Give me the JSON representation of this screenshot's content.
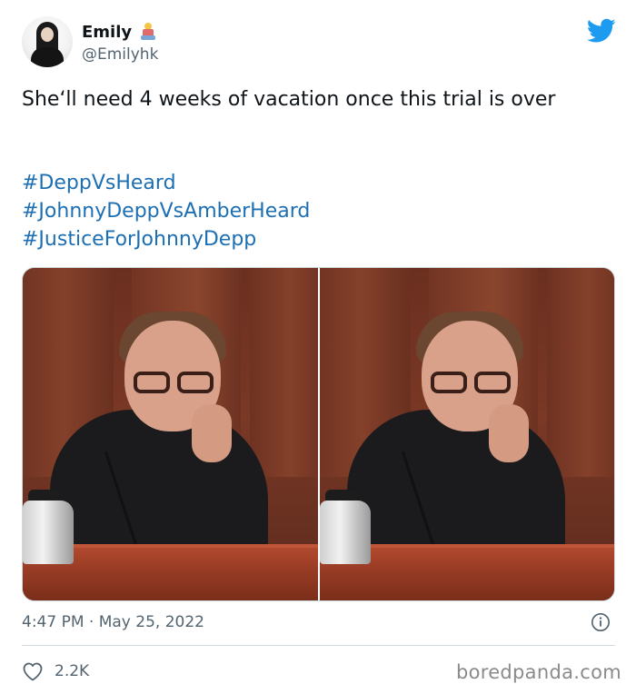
{
  "user": {
    "display_name": "Emily",
    "handle": "@Emilyhk",
    "avatar_icon": "profile-photo",
    "badge_icon": "emoji-badge-icon"
  },
  "brand": {
    "logo_icon": "twitter-bird-icon",
    "accent_color": "#1d9bf0",
    "hashtag_color": "#1d6fb3"
  },
  "tweet": {
    "text": "She‘ll need 4 weeks of vacation once this trial is over",
    "hashtags": [
      "#DeppVsHeard",
      "#JohnnyDeppVsAmberHeard",
      "#JusticeForJohnnyDepp"
    ],
    "timestamp": "4:47 PM · May 25, 2022",
    "likes": "2.2K",
    "info_icon": "info-icon",
    "like_icon": "heart-icon"
  },
  "watermark": "boredpanda.com"
}
